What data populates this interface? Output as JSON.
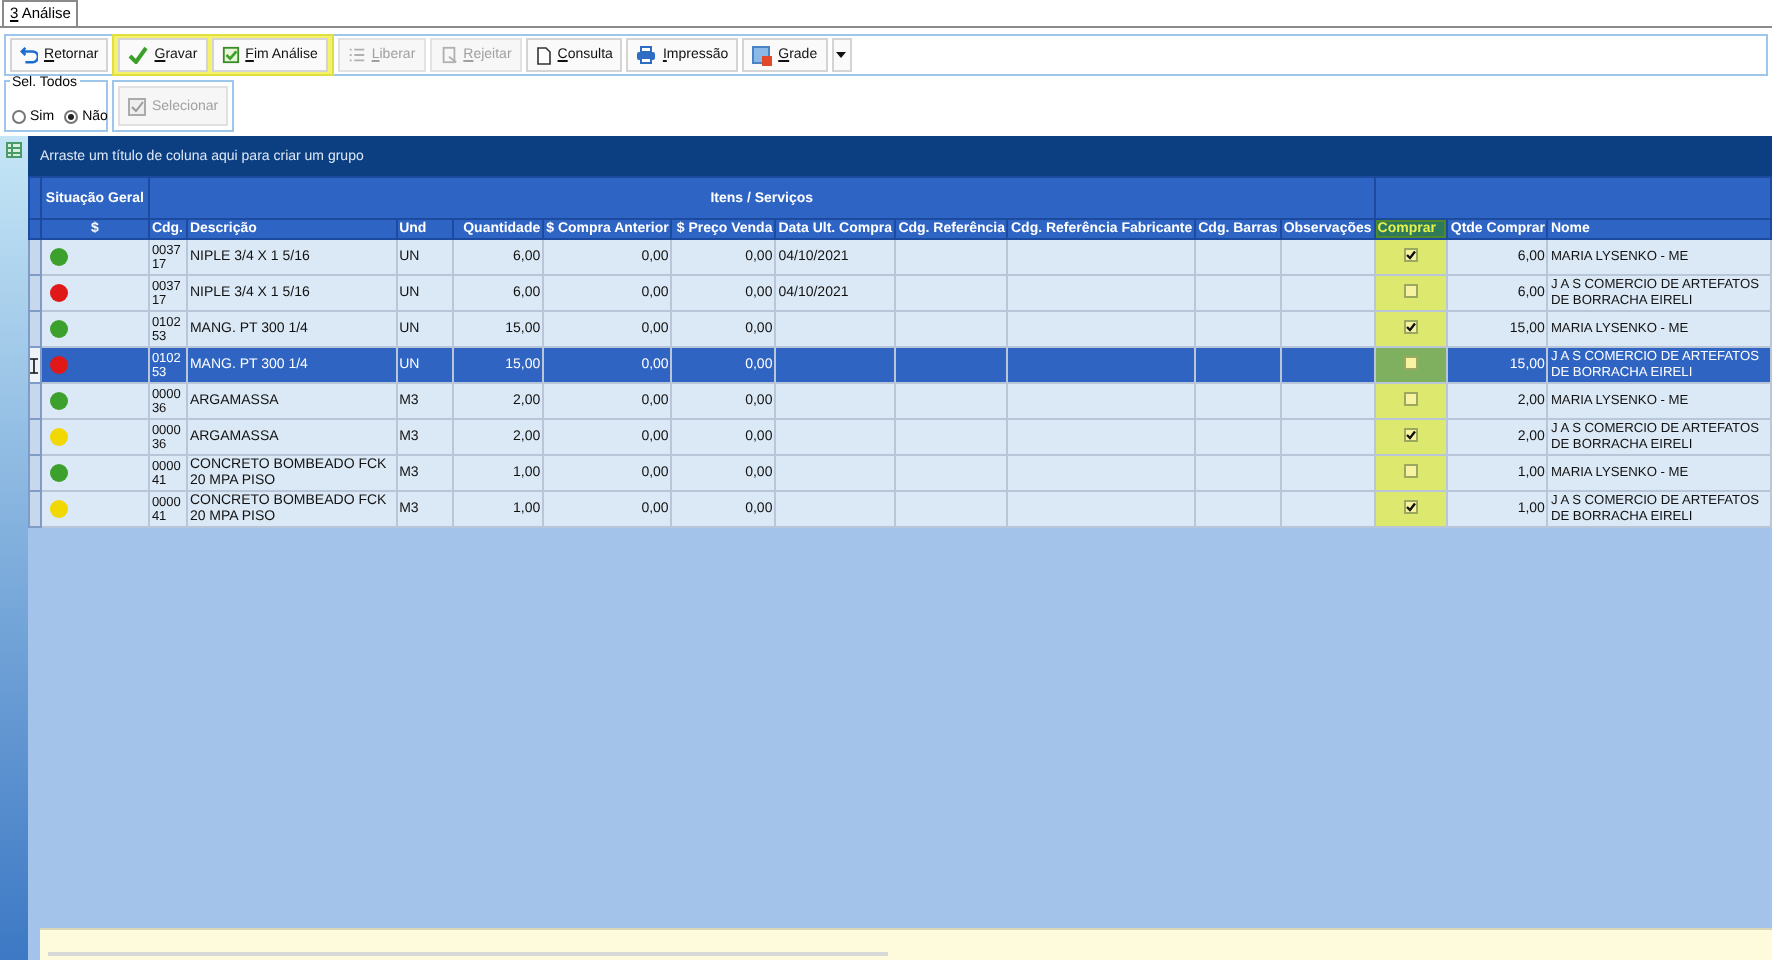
{
  "tab": {
    "label": "3 Análise",
    "selected": true
  },
  "toolbar": {
    "buttons": [
      {
        "kind": "back",
        "label": "Retornar",
        "disabled": false,
        "highlighted": false
      },
      {
        "kind": "check",
        "label": "Gravar",
        "disabled": false,
        "highlighted": true
      },
      {
        "kind": "finish",
        "label": "Fim Análise",
        "disabled": false,
        "highlighted": true
      },
      {
        "kind": "list",
        "label": "Liberar",
        "disabled": true,
        "highlighted": false
      },
      {
        "kind": "reject",
        "label": "Rejeitar",
        "disabled": true,
        "highlighted": false
      },
      {
        "kind": "doc",
        "label": "Consulta",
        "disabled": false,
        "highlighted": false
      },
      {
        "kind": "print",
        "label": "Impressão",
        "disabled": false,
        "highlighted": false
      },
      {
        "kind": "grid",
        "label": "Grade",
        "disabled": false,
        "highlighted": false
      }
    ]
  },
  "select_all": {
    "legend": "Sel. Todos",
    "options": [
      {
        "label": "Sim",
        "selected": false
      },
      {
        "label": "Não",
        "selected": true
      }
    ]
  },
  "select_button": {
    "label": "Selecionar",
    "disabled": true
  },
  "grid": {
    "group_panel": "Arraste um título de coluna aqui para criar um grupo",
    "bands": [
      {
        "label": "Situação Geral",
        "columns": [
          {
            "label": "$",
            "highlighted": false
          }
        ]
      },
      {
        "label": "Itens / Serviços",
        "columns": [
          {
            "label": "Cdg.",
            "highlighted": false
          },
          {
            "label": "Descrição",
            "highlighted": false
          },
          {
            "label": "Und",
            "highlighted": false
          },
          {
            "label": "Quantidade",
            "highlighted": false
          },
          {
            "label": "$ Compra Anterior",
            "highlighted": false
          },
          {
            "label": "$ Preço Venda",
            "highlighted": false
          },
          {
            "label": "Data Ult. Compra",
            "highlighted": false
          },
          {
            "label": "Cdg. Referência",
            "highlighted": false
          },
          {
            "label": "Cdg. Referência Fabricante",
            "highlighted": false
          },
          {
            "label": "Cdg. Barras",
            "highlighted": false
          },
          {
            "label": "Observações",
            "highlighted": false
          }
        ]
      },
      {
        "columns": [
          {
            "label": "Comprar",
            "highlighted": true
          },
          {
            "label": "Qtde Comprar",
            "highlighted": false
          },
          {
            "label": "Nome",
            "highlighted": false
          }
        ]
      }
    ],
    "rows": [
      {
        "color": "#3ca02c",
        "selected": false,
        "code": "003717",
        "description": "NIPLE 3/4 X 1 5/16",
        "unit": "UN",
        "quantity": "6,00",
        "previous_price": "0,00",
        "sale_price": "0,00",
        "last_purchase": "04/10/2021",
        "buy": true,
        "buy_qty": "6,00",
        "supplier": "MARIA LYSENKO - ME"
      },
      {
        "color": "#e01818",
        "selected": false,
        "code": "003717",
        "description": "NIPLE 3/4 X 1 5/16",
        "unit": "UN",
        "quantity": "6,00",
        "previous_price": "0,00",
        "sale_price": "0,00",
        "last_purchase": "04/10/2021",
        "buy": false,
        "buy_qty": "6,00",
        "supplier": "J A S COMERCIO DE ARTEFATOS DE BORRACHA EIRELI"
      },
      {
        "color": "#3ca02c",
        "selected": false,
        "code": "010253",
        "description": " MANG. PT 300 1/4",
        "unit": "UN",
        "quantity": "15,00",
        "previous_price": "0,00",
        "sale_price": "0,00",
        "buy": true,
        "buy_qty": "15,00",
        "supplier": "MARIA LYSENKO - ME"
      },
      {
        "color": "#e01818",
        "selected": true,
        "code": "010253",
        "description": " MANG. PT 300 1/4",
        "unit": "UN",
        "quantity": "15,00",
        "previous_price": "0,00",
        "sale_price": "0,00",
        "buy": false,
        "buy_qty": "15,00",
        "supplier": "J A S COMERCIO DE ARTEFATOS DE BORRACHA EIRELI"
      },
      {
        "color": "#3ca02c",
        "selected": false,
        "code": "000036",
        "description": "ARGAMASSA",
        "unit": "M3",
        "quantity": "2,00",
        "previous_price": "0,00",
        "sale_price": "0,00",
        "buy": false,
        "buy_qty": "2,00",
        "supplier": "MARIA LYSENKO - ME"
      },
      {
        "color": "#f0d800",
        "selected": false,
        "code": "000036",
        "description": "ARGAMASSA",
        "unit": "M3",
        "quantity": "2,00",
        "previous_price": "0,00",
        "sale_price": "0,00",
        "buy": true,
        "buy_qty": "2,00",
        "supplier": "J A S COMERCIO DE ARTEFATOS DE BORRACHA EIRELI"
      },
      {
        "color": "#3ca02c",
        "selected": false,
        "code": "000041",
        "description": "CONCRETO BOMBEADO FCK 20 MPA PISO",
        "unit": "M3",
        "quantity": "1,00",
        "previous_price": "0,00",
        "sale_price": "0,00",
        "buy": false,
        "buy_qty": "1,00",
        "supplier": "MARIA LYSENKO - ME"
      },
      {
        "color": "#f0d800",
        "selected": false,
        "code": "000041",
        "description": "CONCRETO BOMBEADO FCK 20 MPA PISO",
        "unit": "M3",
        "quantity": "1,00",
        "previous_price": "0,00",
        "sale_price": "0,00",
        "buy": true,
        "buy_qty": "1,00",
        "supplier": "J A S COMERCIO DE ARTEFATOS DE BORRACHA EIRELI"
      }
    ]
  }
}
